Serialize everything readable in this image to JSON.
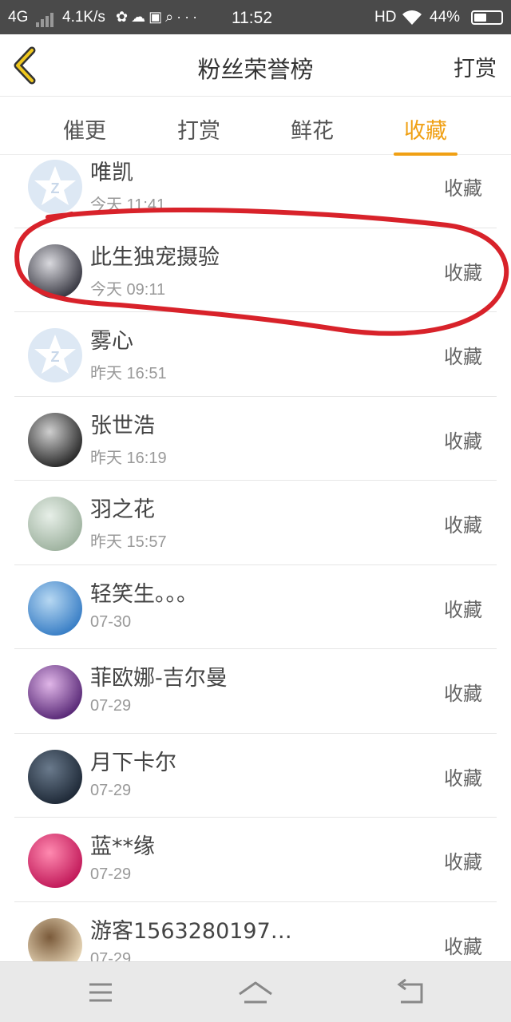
{
  "status_bar": {
    "network": "4G",
    "speed": "4.1K/s",
    "notif_icons": "✿☁▣⌕···",
    "time": "11:52",
    "hd": "HD",
    "battery_pct": "44%"
  },
  "header": {
    "title": "粉丝荣誉榜",
    "right_action": "打赏"
  },
  "tabs": [
    {
      "label": "催更",
      "active": false
    },
    {
      "label": "打赏",
      "active": false
    },
    {
      "label": "鲜花",
      "active": false
    },
    {
      "label": "收藏",
      "active": true
    }
  ],
  "accent_color": "#f0a014",
  "highlight_color": "#d8222a",
  "fans": [
    {
      "name": "唯凯",
      "time": "今天 11:41",
      "action": "收藏",
      "avatar": "default-avatar-icon"
    },
    {
      "name": "此生独宠摄验",
      "time": "今天 09:11",
      "action": "收藏",
      "avatar": "user-avatar-image"
    },
    {
      "name": "雾心",
      "time": "昨天 16:51",
      "action": "收藏",
      "avatar": "default-avatar-icon"
    },
    {
      "name": "张世浩",
      "time": "昨天 16:19",
      "action": "收藏",
      "avatar": "user-avatar-image"
    },
    {
      "name": "羽之花",
      "time": "昨天 15:57",
      "action": "收藏",
      "avatar": "user-avatar-image"
    },
    {
      "name": "轻笑生。。。",
      "time": "07-30",
      "action": "收藏",
      "avatar": "user-avatar-image"
    },
    {
      "name": "菲欧娜-吉尔曼",
      "time": "07-29",
      "action": "收藏",
      "avatar": "user-avatar-image"
    },
    {
      "name": "月下卡尔",
      "time": "07-29",
      "action": "收藏",
      "avatar": "user-avatar-image"
    },
    {
      "name": "蓝**缘",
      "time": "07-29",
      "action": "收藏",
      "avatar": "user-avatar-image"
    },
    {
      "name": "游客1563280197…",
      "time": "07-29",
      "action": "收藏",
      "avatar": "user-avatar-image"
    }
  ],
  "nav_bar": {
    "buttons": [
      "menu-icon",
      "home-icon",
      "back-icon"
    ]
  }
}
